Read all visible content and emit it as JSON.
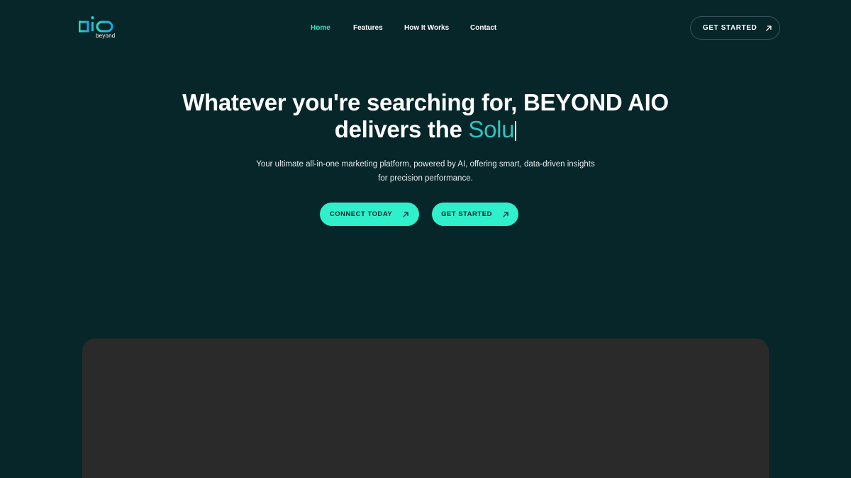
{
  "brand": {
    "logo_text": "aio",
    "logo_subtext": "beyond",
    "accent_color": "#2ee6c4"
  },
  "nav": {
    "items": [
      {
        "label": "Home",
        "active": true
      },
      {
        "label": "Features",
        "active": false
      },
      {
        "label": "How It Works",
        "active": false
      },
      {
        "label": "Contact",
        "active": false
      }
    ]
  },
  "header": {
    "cta_label": "GET STARTED",
    "cta_icon": "arrow-up-right-icon"
  },
  "hero": {
    "title_line1": "Whatever you're searching for, BEYOND AIO",
    "title_line2_prefix": "delivers the ",
    "title_typed": "Solu",
    "subtitle_line1": "Your ultimate all-in-one marketing platform, powered by AI, offering smart, data-driven insights",
    "subtitle_line2": "for precision performance.",
    "buttons": [
      {
        "label": "CONNECT TODAY",
        "icon": "arrow-up-right-icon"
      },
      {
        "label": "GET STARTED",
        "icon": "arrow-up-right-icon"
      }
    ]
  },
  "colors": {
    "background": "#07262a",
    "button": "#2ff0cb",
    "typed_text": "#2ec5c0",
    "panel": "#2a2a2a"
  }
}
